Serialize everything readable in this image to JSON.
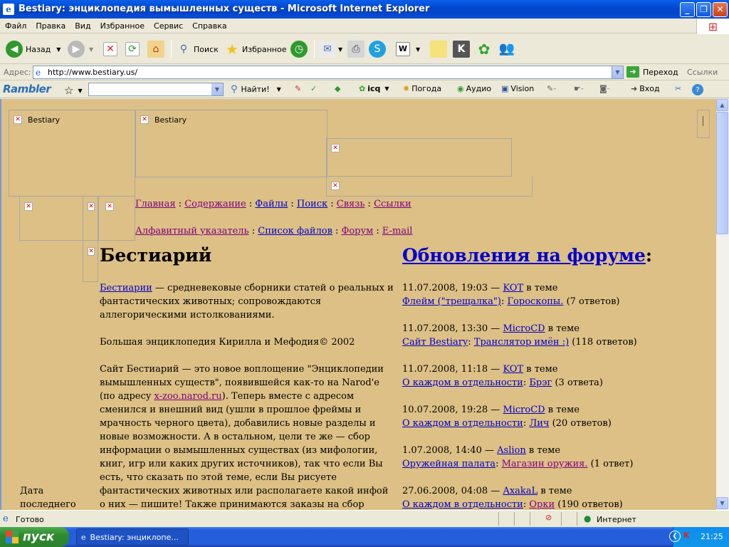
{
  "window": {
    "title": "Bestiary: энциклопедия вымышленных существ - Microsoft Internet Explorer"
  },
  "menu": [
    "Файл",
    "Правка",
    "Вид",
    "Избранное",
    "Сервис",
    "Справка"
  ],
  "toolbar": {
    "back": "Назад",
    "search": "Поиск",
    "favorites": "Избранное"
  },
  "address": {
    "label": "Адрес:",
    "url": "http://www.bestiary.us/",
    "go": "Переход",
    "links": "Ссылки"
  },
  "rambler": {
    "logo": "Rambler",
    "find": "Найти!",
    "icq": "icq",
    "weather": "Погода",
    "audio": "Аудио",
    "vision": "Vision",
    "login": "Вход"
  },
  "page": {
    "broken_images": {
      "bestiary_1": "Bestiary",
      "bestiary_2": "Bestiary"
    },
    "nav1": [
      "Главная",
      "Содержание",
      "Файлы",
      "Поиск",
      "Связь",
      "Ссылки"
    ],
    "nav2": [
      "Алфавитный указатель",
      "Список файлов",
      "Форум",
      "E-mail"
    ],
    "left_title": "Бестиарий",
    "intro_link": "Бестиарии",
    "intro_text": " — средневековые сборники статей о реальных и фантастических животных; сопровождаются аллегорическими истолкованиями.",
    "source": "Большая энциклопедия Кирилла и Мефодия© 2002",
    "body_1": "Сайт Бестиарий — это новое воплощение \"Энциклопедии вымышленных существ\", появившейся как-то на Narod'e (по адресу ",
    "body_link": "x-zoo.narod.ru",
    "body_2": "). Теперь вместе с адресом сменился и внешний вид (ушли в прошлое фреймы и мрачность черного цвета), добавились новые разделы и новые возможности. А в остальном, цели те же — сбор информации о вымышленных существах (из мифологии, книг, игр или каких других источников), так что если Вы есть, что сказать по этой теме, если Вы рисуете фантастических животных или располагаете какой инфой о них — пишите! Также принимаются заказы на сбор информации о существах.",
    "side_label": "Дата последнего",
    "right_title_link": "Обновления на форуме",
    "right_title_tail": ":",
    "in_theme": "в теме",
    "updates": [
      {
        "date": "11.07.2008, 19:03 —",
        "user": "KOT",
        "forum": "Флейм (\"трещалка\")",
        "topic": "Гороскопы.",
        "count": "(7 ответов)"
      },
      {
        "date": "11.07.2008, 13:30 —",
        "user": "MicroCD",
        "forum": "Сайт Bestiary",
        "topic": "Транслятор имён :)",
        "count": "(118 ответов)"
      },
      {
        "date": "11.07.2008, 11:18 —",
        "user": "KOT",
        "forum": "О каждом в отдельности",
        "topic": "Брэг",
        "count": "(3 ответа)"
      },
      {
        "date": "10.07.2008, 19:28 —",
        "user": "MicroCD",
        "forum": "О каждом в отдельности",
        "topic": "Лич",
        "count": "(20 ответов)"
      },
      {
        "date": "1.07.2008, 14:40 —",
        "user": "Aslion",
        "forum": "Оружейная палата",
        "topic": "Магазин оружия.",
        "count": "(1 ответ)"
      },
      {
        "date": "27.06.2008, 04:08 —",
        "user": "AxakaL",
        "forum": "О каждом в отдельности",
        "topic": "Орки",
        "count": "(190 ответов)"
      }
    ]
  },
  "status": {
    "text": "Готово",
    "zone": "Интернет"
  },
  "taskbar": {
    "start": "пуск",
    "task": "Bestiary: энциклопе...",
    "clock": "21:25"
  },
  "colors": {
    "page_bg": "#ddc085",
    "link_unvisited": "#0000cc",
    "link_visited": "#800080"
  }
}
